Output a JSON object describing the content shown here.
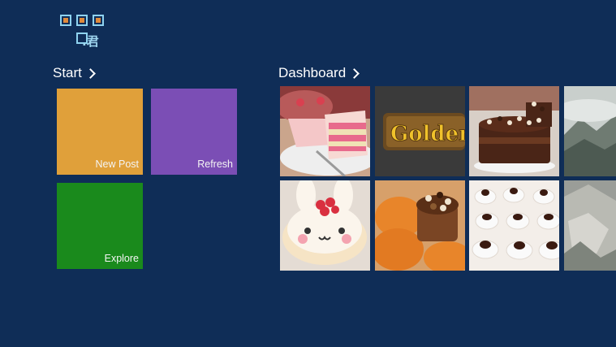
{
  "logo": {
    "glyph": "君",
    "dot": "."
  },
  "start": {
    "title": "Start",
    "tiles": [
      {
        "label": "New Post",
        "color": "#e0a03a"
      },
      {
        "label": "Refresh",
        "color": "#7b4eb5"
      },
      {
        "label": "Explore",
        "color": "#1a8a1c"
      }
    ]
  },
  "dashboard": {
    "title": "Dashboard",
    "photos": [
      {
        "name": "strawberry-layer-cake"
      },
      {
        "name": "golden-logo-sign",
        "text": "Golden"
      },
      {
        "name": "chocolate-layer-cake"
      },
      {
        "name": "misty-mountain"
      },
      {
        "name": "bunny-face-cake"
      },
      {
        "name": "pumpkins-chocolate-cup"
      },
      {
        "name": "chocolate-meringue-drops"
      },
      {
        "name": "rocky-cliff"
      }
    ]
  },
  "colors": {
    "background": "#0f2d57",
    "logo_accent": "#8fd3f0",
    "logo_inner": "#e08a3c"
  }
}
